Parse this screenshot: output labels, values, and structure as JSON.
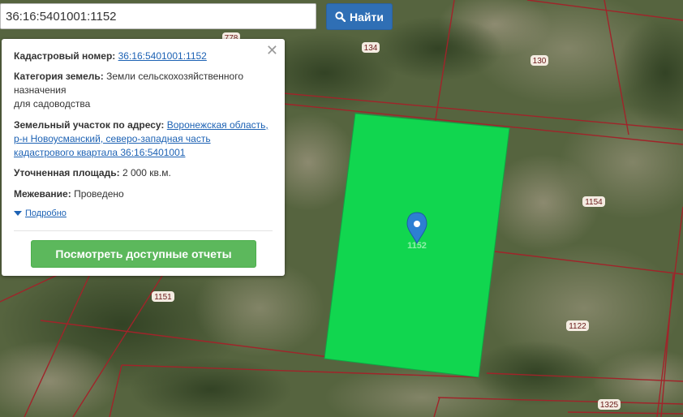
{
  "search": {
    "value": "36:16:5401001:1152",
    "button_label": "Найти"
  },
  "popup": {
    "cadastral_label": "Кадастровый номер:",
    "cadastral_value": "36:16:5401001:1152",
    "category_label": "Категория земель:",
    "category_value_line1": "Земли сельскохозяйственного",
    "category_value_line2": "назначения",
    "category_value_line3": "для садоводства",
    "address_label": "Земельный участок по адресу:",
    "address_line1": "Воронежская область,",
    "address_line2": "р-н Новоусманский, северо-западная часть",
    "address_line3": "кадастрового квартала 36:16:5401001",
    "area_label": "Уточненная площадь:",
    "area_value": "2 000 кв.м.",
    "survey_label": "Межевание:",
    "survey_value": "Проведено",
    "details_label": "Подробно",
    "reports_button": "Посмотреть доступные отчеты"
  },
  "map": {
    "parcel_labels": {
      "p134": "134",
      "p130": "130",
      "p1154": "1154",
      "p1151": "1151",
      "p1122": "1122",
      "p1325": "1325",
      "p1152": "1152",
      "p_partial": "778"
    },
    "colors": {
      "highlight": "#11d64f",
      "boundary": "#a0242a",
      "search_button": "#2f6fb5",
      "reports_button": "#5cb85c",
      "marker": "#2d7fd3"
    }
  }
}
